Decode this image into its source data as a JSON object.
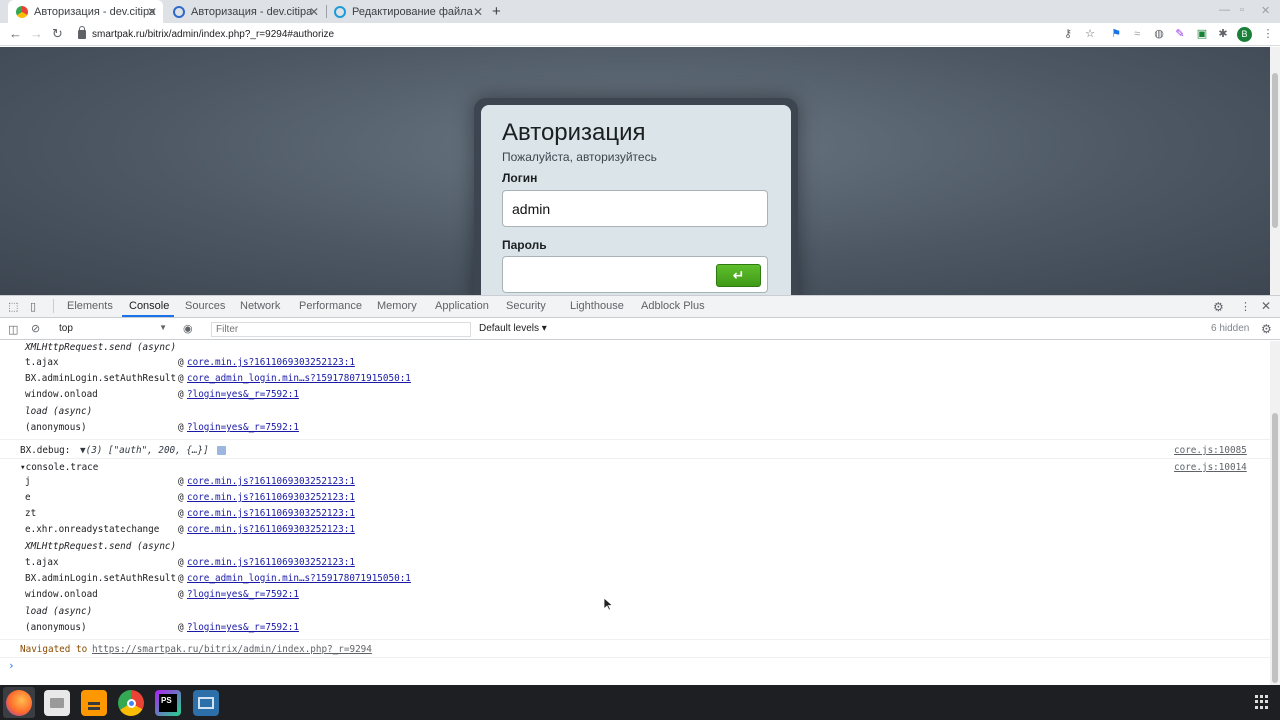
{
  "browser": {
    "tabs": [
      {
        "title": "Авторизация - dev.citipa",
        "active": true
      },
      {
        "title": "Авторизация - dev.citipa",
        "active": false
      },
      {
        "title": "Редактирование файла",
        "active": false
      }
    ],
    "new_tab": "+",
    "url": "smartpak.ru/bitrix/admin/index.php?_r=9294#authorize",
    "profile_letter": "B"
  },
  "auth": {
    "title": "Авторизация",
    "subtitle": "Пожалуйста, авторизуйтесь",
    "login_label": "Логин",
    "login_value": "admin",
    "password_label": "Пароль",
    "submit_glyph": "↵"
  },
  "devtools": {
    "tabs": [
      "Elements",
      "Console",
      "Sources",
      "Network",
      "Performance",
      "Memory",
      "Application",
      "Security",
      "Lighthouse",
      "Adblock Plus"
    ],
    "active_tab": "Console",
    "context": "top",
    "filter_placeholder": "Filter",
    "levels": "Default levels ▾",
    "hidden": "6 hidden"
  },
  "console": {
    "first_trace": [
      {
        "name": "XMLHttpRequest.send (async)",
        "async": true
      },
      {
        "name": "t.ajax",
        "link": "core.min.js?16110693032521​23:1"
      },
      {
        "name": "BX.adminLogin.setAuthResult",
        "link": "core_admin_login.min…s?159178071915050:1"
      },
      {
        "name": "window.onload",
        "link": "?login=yes&_r=7592:1"
      },
      {
        "name": "load (async)",
        "async": true
      },
      {
        "name": "(anonymous)",
        "link": "?login=yes&_r=7592:1"
      }
    ],
    "debug": {
      "label": "BX.debug:",
      "value": "▼(3) [\"auth\", 200, {…}]",
      "source": "core.js:10085"
    },
    "trace": {
      "label": "▾console.trace",
      "source": "core.js:10014"
    },
    "second_trace": [
      {
        "name": "j",
        "link": "core.min.js?1611069303252123:1"
      },
      {
        "name": "e",
        "link": "core.min.js?1611069303252123:1"
      },
      {
        "name": "zt",
        "link": "core.min.js?1611069303252123:1"
      },
      {
        "name": "e.xhr.onreadystatechange",
        "link": "core.min.js?1611069303252123:1"
      },
      {
        "name": "XMLHttpRequest.send (async)",
        "async": true
      },
      {
        "name": "t.ajax",
        "link": "core.min.js?1611069303252123:1"
      },
      {
        "name": "BX.adminLogin.setAuthResult",
        "link": "core_admin_login.min…s?159178071915050:1"
      },
      {
        "name": "window.onload",
        "link": "?login=yes&_r=7592:1"
      },
      {
        "name": "load (async)",
        "async": true
      },
      {
        "name": "(anonymous)",
        "link": "?login=yes&_r=7592:1"
      }
    ],
    "navigated_prefix": "Navigated to",
    "navigated_url": "https://smartpak.ru/bitrix/admin/index.php?_r=9294",
    "prompt": "›"
  },
  "taskbar": {
    "apps": [
      "firefox-icon",
      "files-icon",
      "sublime-icon",
      "chrome-icon",
      "phpstorm-icon",
      "network-icon"
    ],
    "phpstorm_label": "PS"
  }
}
